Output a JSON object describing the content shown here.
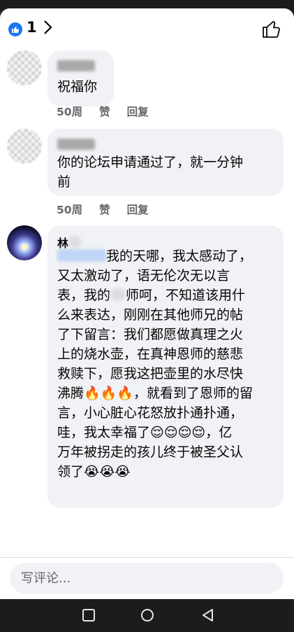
{
  "header": {
    "like_count": "1",
    "chevron": "›"
  },
  "comments": [
    {
      "text": "祝福你",
      "age": "50周",
      "like_label": "赞",
      "reply_label": "回复"
    },
    {
      "text_line1": "你的论坛申请通过了，就一分钟",
      "text_line2": "前",
      "age": "50周",
      "like_label": "赞",
      "reply_label": "回复"
    },
    {
      "author": "林",
      "line1": "我的天哪，我太感动了，",
      "line2": "又太激动了，语无伦次无以言",
      "line3a": "表，我的",
      "line3b": "师呵，不知道该用什",
      "line4": "么来表达，刚刚在其他师兄的帖",
      "line5": "了下留言：我们都愿做真理之火",
      "line6": "上的烧水壶，在真神恩师的慈悲",
      "line7": "救赎下，愿我这把壶里的水尽快",
      "line8a": "沸腾",
      "line8_emoji": "🔥🔥🔥",
      "line8b": "，就看到了恩师的留",
      "line9": "言，小心脏心花怒放扑通扑通，",
      "line10a": "哇，我太幸福了",
      "line10_emoji": "😌😌😌😌",
      "line10b": "，亿",
      "line11": "万年被拐走的孩儿终于被圣父认",
      "line12a": "领了",
      "line12_emoji": "😭😭😭"
    }
  ],
  "composer": {
    "placeholder": "写评论..."
  },
  "colors": {
    "like_blue": "#1877f2",
    "bubble": "#f0f2f5",
    "meta_gray": "#65676b"
  },
  "icons": [
    "like-reaction-icon",
    "chevron-right-icon",
    "thumbs-up-icon",
    "square-recents-icon",
    "circle-home-icon",
    "triangle-back-icon"
  ]
}
